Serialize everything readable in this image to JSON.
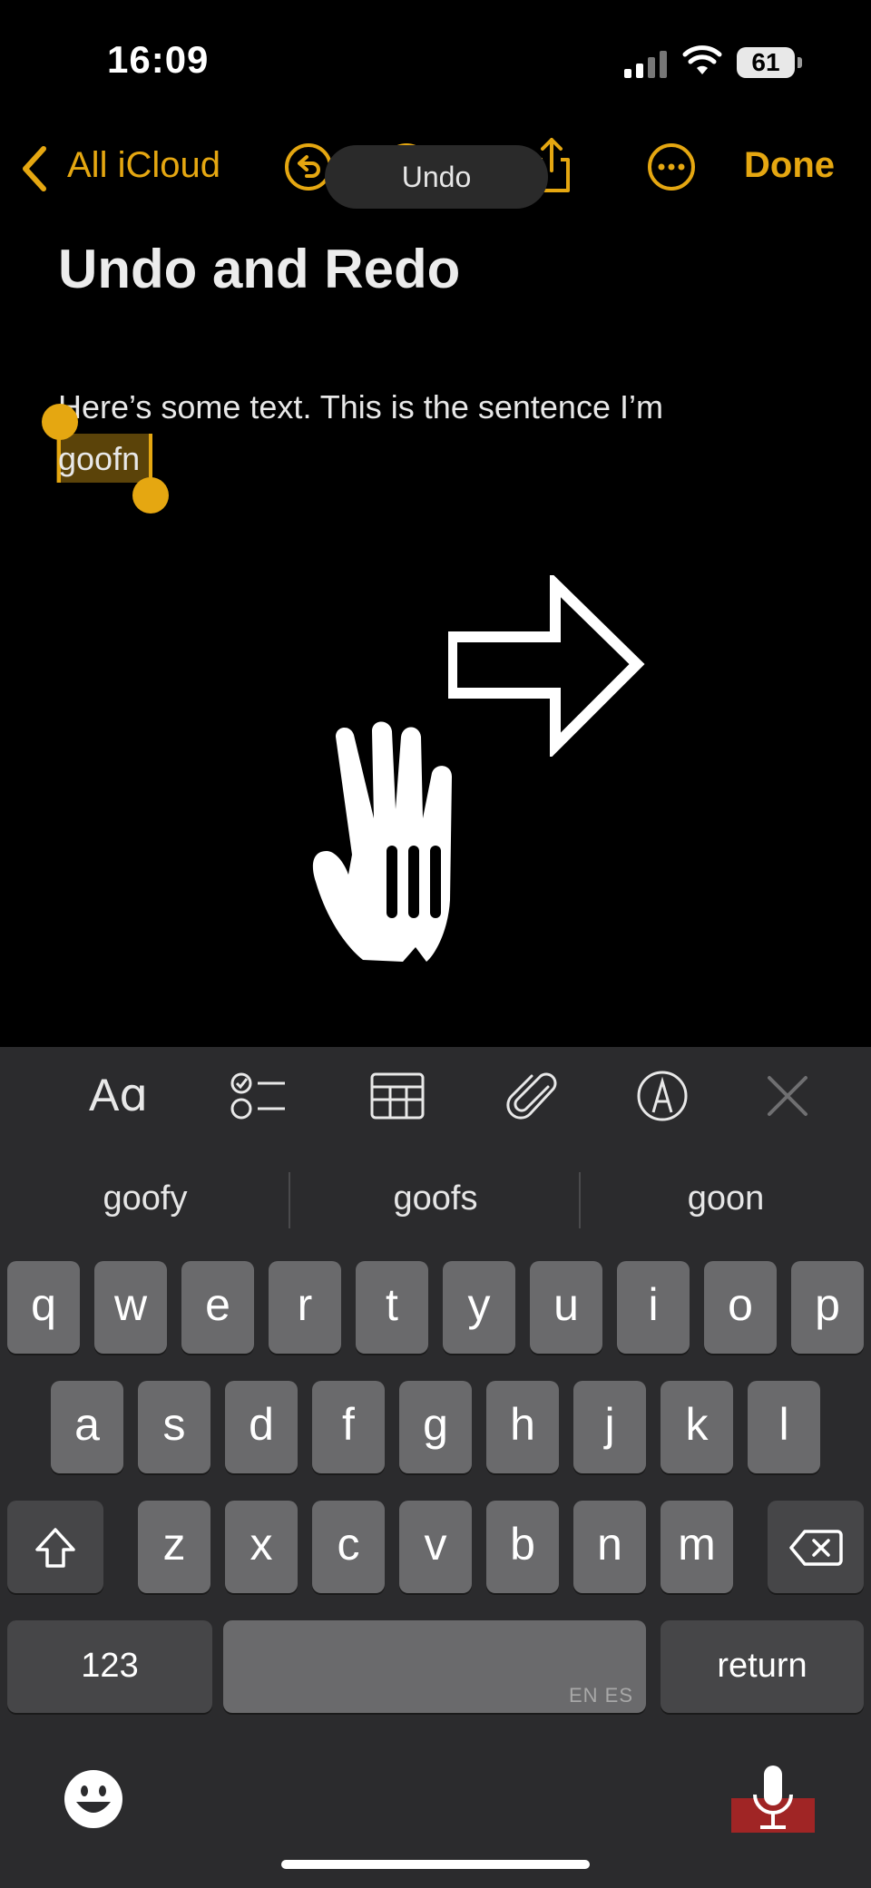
{
  "status_bar": {
    "time": "16:09",
    "battery": "61"
  },
  "nav": {
    "back_label": "All iCloud",
    "done_label": "Done",
    "toast": "Undo"
  },
  "note": {
    "title": "Undo and Redo",
    "body_line1": "Here’s some text. This is the sentence I’m",
    "selected_word": "goofn"
  },
  "suggestions": [
    "goofy",
    "goofs",
    "goon"
  ],
  "keyboard": {
    "row1": [
      "q",
      "w",
      "e",
      "r",
      "t",
      "y",
      "u",
      "i",
      "o",
      "p"
    ],
    "row2": [
      "a",
      "s",
      "d",
      "f",
      "g",
      "h",
      "j",
      "k",
      "l"
    ],
    "row3": [
      "z",
      "x",
      "c",
      "v",
      "b",
      "n",
      "m"
    ],
    "numbers_label": "123",
    "return_label": "return",
    "space_lang": "EN ES"
  },
  "colors": {
    "accent": "#e5a711",
    "keyboard_bg": "#2b2b2d",
    "key": "#6a6a6c"
  }
}
